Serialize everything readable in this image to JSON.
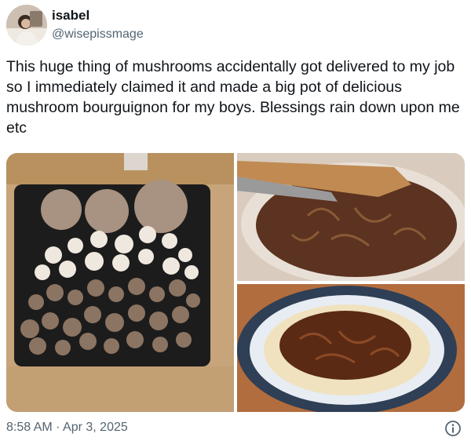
{
  "author": {
    "display_name": "isabel",
    "handle": "@wisepissmage"
  },
  "tweet": {
    "text": "This huge thing of mushrooms accidentally got delivered to my job so I immediately claimed it and made a big pot of delicious mushroom bourguignon for my boys. Blessings rain down upon me etc",
    "timestamp": "8:58 AM · Apr 3, 2025"
  },
  "icons": {
    "info": "info-circle-icon"
  },
  "colors": {
    "text": "#0f1419",
    "secondary_text": "#536471"
  }
}
